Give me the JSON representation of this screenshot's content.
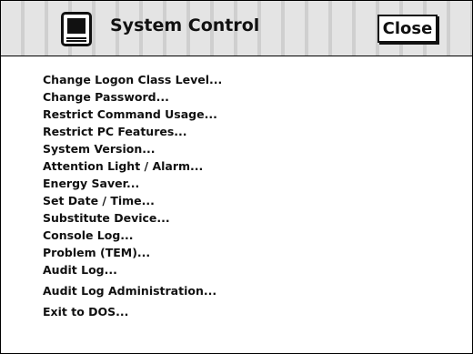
{
  "window": {
    "title": "System Control",
    "icon": "computer-icon",
    "close_label": "Close"
  },
  "menu": {
    "items": [
      {
        "label": "Change Logon Class Level..."
      },
      {
        "label": "Change Password..."
      },
      {
        "label": "Restrict Command Usage..."
      },
      {
        "label": "Restrict PC Features..."
      },
      {
        "label": "System Version..."
      },
      {
        "label": "Attention Light / Alarm..."
      },
      {
        "label": "Energy Saver..."
      },
      {
        "label": "Set Date / Time..."
      },
      {
        "label": "Substitute Device..."
      },
      {
        "label": "Console Log..."
      },
      {
        "label": "Problem (TEM)..."
      },
      {
        "label": "Audit Log..."
      },
      {
        "label": "Audit Log Administration..."
      },
      {
        "label": "Exit to DOS..."
      }
    ]
  }
}
